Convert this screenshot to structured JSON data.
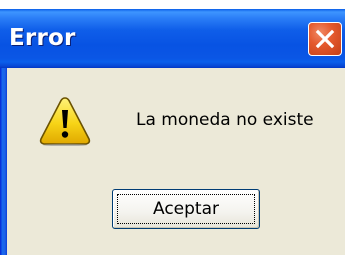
{
  "dialog": {
    "title": "Error",
    "message": "La moneda no existe",
    "icon": "warning-icon",
    "buttons": {
      "ok_label": "Aceptar"
    },
    "colors": {
      "titlebar": "#0a56e5",
      "client_background": "#ece9d8",
      "close_button": "#e55a2e",
      "warning_fill": "#f7d417"
    }
  }
}
